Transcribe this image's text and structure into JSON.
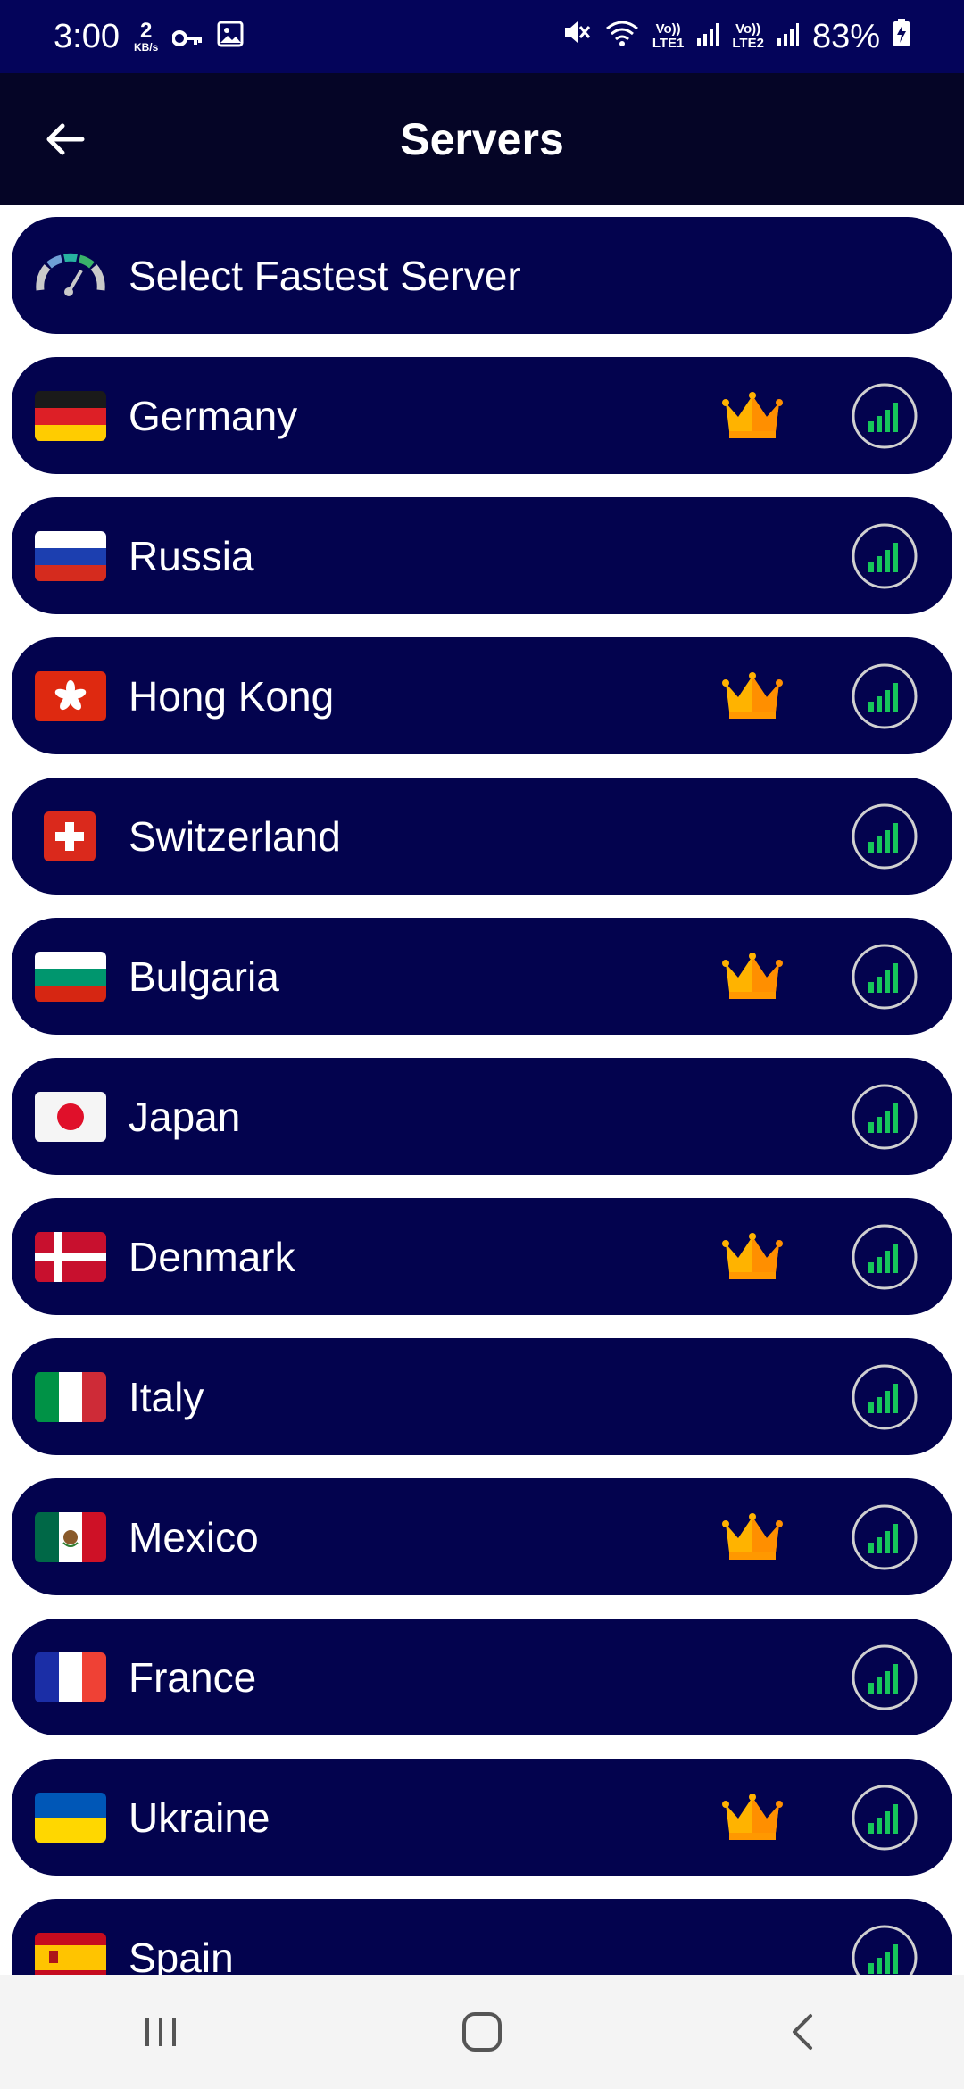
{
  "status_bar": {
    "time": "3:00",
    "speed_value": "2",
    "speed_unit": "KB/s",
    "sim1_top": "Vo))",
    "sim1_bottom": "LTE1",
    "sim2_top": "Vo))",
    "sim2_bottom": "LTE2",
    "battery": "83%"
  },
  "app_bar": {
    "title": "Servers",
    "back_icon": "arrow-left-icon"
  },
  "fastest": {
    "label": "Select Fastest Server",
    "icon": "speedometer-icon"
  },
  "servers": [
    {
      "name": "Germany",
      "premium": true
    },
    {
      "name": "Russia",
      "premium": false
    },
    {
      "name": "Hong Kong",
      "premium": true
    },
    {
      "name": "Switzerland",
      "premium": false
    },
    {
      "name": "Bulgaria",
      "premium": true
    },
    {
      "name": "Japan",
      "premium": false
    },
    {
      "name": "Denmark",
      "premium": true
    },
    {
      "name": "Italy",
      "premium": false
    },
    {
      "name": "Mexico",
      "premium": true
    },
    {
      "name": "France",
      "premium": false
    },
    {
      "name": "Ukraine",
      "premium": true
    },
    {
      "name": "Spain",
      "premium": false
    }
  ],
  "colors": {
    "row_bg": "#03034e",
    "status_bg": "#04045a",
    "app_bar_bg": "#050526",
    "signal_green": "#16c65a",
    "crown_gold": "#ffb300"
  },
  "nav": {
    "recents_icon": "recents-icon",
    "home_icon": "home-icon",
    "back_icon": "nav-back-icon"
  }
}
